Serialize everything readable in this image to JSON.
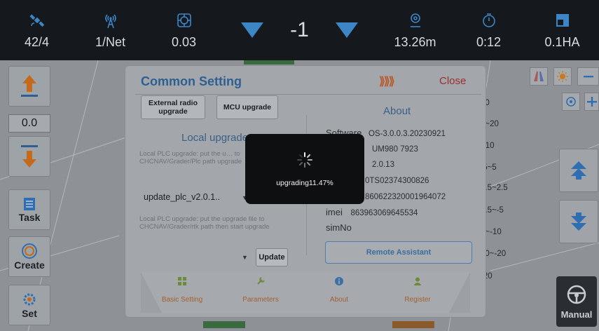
{
  "status_bar": {
    "satellites": "42/4",
    "network": "1/Net",
    "precision": "0.03",
    "offset": "-1",
    "distance": "13.26m",
    "time": "0:12",
    "area": "0.1HA"
  },
  "left_tools": {
    "height_value": "0.0",
    "task_label": "Task",
    "create_label": "Create",
    "set_label": "Set"
  },
  "right_scale": [
    "20",
    "0~20",
    "~10",
    ".5~5",
    "2.5~2.5",
    "2.5~-5",
    "5~-10",
    "10~-20",
    "-20"
  ],
  "manual_label": "Manual",
  "dialog": {
    "title": "Common Setting",
    "arrows": "⟫⟫⟫",
    "close_label": "Close",
    "external_radio_label": "External radio upgrade",
    "mcu_upgrade_label": "MCU upgrade",
    "local_upgrade_title": "Local upgrade",
    "plc_hint": "Local PLC upgrade: put the upgrade file to CHCNAV/Grader/Plc path then start upgrade",
    "plc_hint_visible": "Local PLC upgrade: put the u… to CHCNAV/Grader/Plc path upgrade",
    "plc_file": "update_plc_v2.0.1..",
    "rtk_hint": "Local PLC upgrade: put the upgrade file to CHCNAV/Grader/rtk path then start upgrade",
    "update_label": "Update",
    "about_title": "About",
    "about": {
      "software_key": "Software",
      "software_val": "OS-3.0.0.3.20230921",
      "board_val": "UM980 7923",
      "version_val": "2.0.13",
      "sn_val": "0TS02374300826",
      "id_val": "860622320001964072",
      "imei_key": "imei",
      "imei_val": "863963069645534",
      "simno_key": "simNo"
    },
    "remote_label": "Remote Assistant",
    "tabs": [
      {
        "label": "Basic Setting",
        "icon": "grid-icon"
      },
      {
        "label": "Parameters",
        "icon": "wrench-icon"
      },
      {
        "label": "About",
        "icon": "info-icon"
      },
      {
        "label": "Register",
        "icon": "person-icon"
      }
    ]
  },
  "progress": {
    "label": "upgrading11.47%",
    "percent": 11.47
  },
  "colors": {
    "accent_blue": "#3d86c6",
    "close_red": "#9c2d2d",
    "title_blue": "#2f5f91"
  }
}
